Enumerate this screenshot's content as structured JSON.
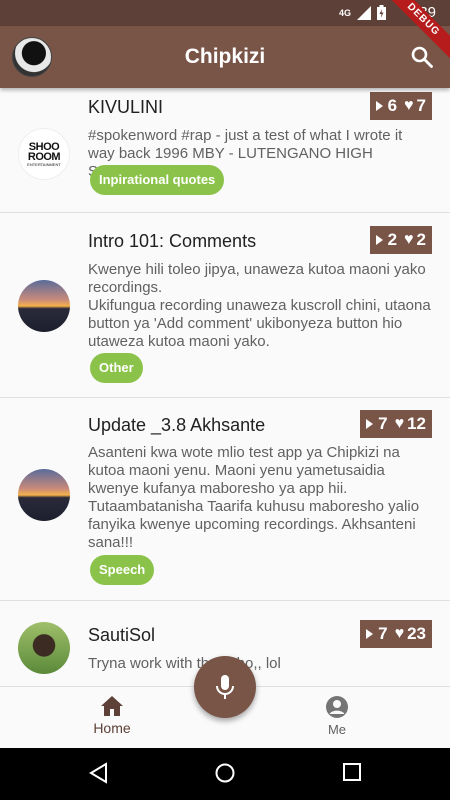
{
  "status_bar": {
    "time": "7:39",
    "network": "4G",
    "debug_label": "DEBUG"
  },
  "app_bar": {
    "title": "Chipkizi"
  },
  "recordings": [
    {
      "name": "KIVULINI",
      "description": "#spokenword #rap - just a test of what I wrote it way back 1996 MBY - LUTENGANO HIGH SCHOOL",
      "category": "Inpirational quotes",
      "plays": "6",
      "likes": "7",
      "thumbnail": "shoo-room-logo",
      "thumbnail_text": [
        "SHOO",
        "ROOM",
        "ENTERTAINMENT"
      ]
    },
    {
      "name": "Intro 101: Comments",
      "description": "Kwenye hili toleo jipya, unaweza kutoa maoni yako recordings.\nUkifungua recording unaweza kuscroll chini, utaona button ya 'Add comment' ukibonyeza button hio utaweza kutoa maoni yako.",
      "category": "Other",
      "plays": "2",
      "likes": "2",
      "thumbnail": "sunset-avatar"
    },
    {
      "name": "Update _3.8 Akhsante",
      "description": "Asanteni kwa wote mlio test app ya Chipkizi na kutoa maoni yenu. Maoni yenu yametusaidia kwenye kufanya maboresho ya app hii. Tutaambatanisha Taarifa kuhusu maboresho yalio fanyika kwenye upcoming recordings. Akhsanteni sana!!!",
      "category": "Speech",
      "plays": "7",
      "likes": "12",
      "thumbnail": "sunset-avatar"
    },
    {
      "name": "SautiSol",
      "description": "Tryna work with th   ys tho,,  lol",
      "plays": "7",
      "likes": "23",
      "thumbnail": "person-avatar"
    }
  ],
  "bottom_nav": {
    "home_label": "Home",
    "me_label": "Me"
  },
  "colors": {
    "primary": "#795548",
    "primary_dark": "#5d4037",
    "chip": "#8bc34a"
  },
  "icons": [
    "avatar",
    "search-icon",
    "play-icon",
    "heart-icon",
    "home-icon",
    "account-icon",
    "mic-icon",
    "back-icon",
    "home-circle-icon",
    "recents-icon"
  ]
}
